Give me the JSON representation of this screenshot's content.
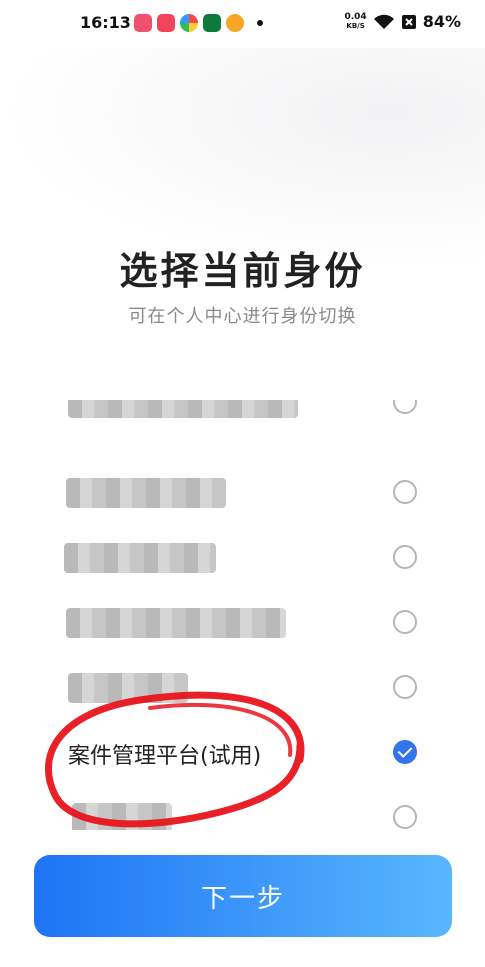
{
  "status_bar": {
    "time": "16:13",
    "net_speed": "0.04",
    "net_unit": "KB/S",
    "battery": "84%",
    "app_icons": [
      {
        "name": "video-app-icon",
        "color": "#f0506e"
      },
      {
        "name": "video-app-icon-2",
        "color": "#f2455c"
      },
      {
        "name": "colorful-app-icon",
        "color": "#3fa0f5"
      },
      {
        "name": "green-app-icon",
        "color": "#0d7a3a"
      },
      {
        "name": "weibo-icon",
        "color": "#f5a623"
      }
    ]
  },
  "header": {
    "title": "选择当前身份",
    "subtitle": "可在个人中心进行身份切换"
  },
  "identities": [
    {
      "label": "",
      "checked": false
    },
    {
      "label": "",
      "checked": false
    },
    {
      "label": "",
      "checked": false
    },
    {
      "label": "",
      "checked": false
    },
    {
      "label": "",
      "checked": false
    },
    {
      "label": "案件管理平台(试用)",
      "checked": true
    },
    {
      "label": "",
      "checked": false
    }
  ],
  "next_button": {
    "label": "下一步"
  },
  "colors": {
    "accent": "#3373ec",
    "button_gradient_start": "#1e74f5",
    "button_gradient_end": "#58b7fd",
    "annotation_red": "#e8141c"
  }
}
